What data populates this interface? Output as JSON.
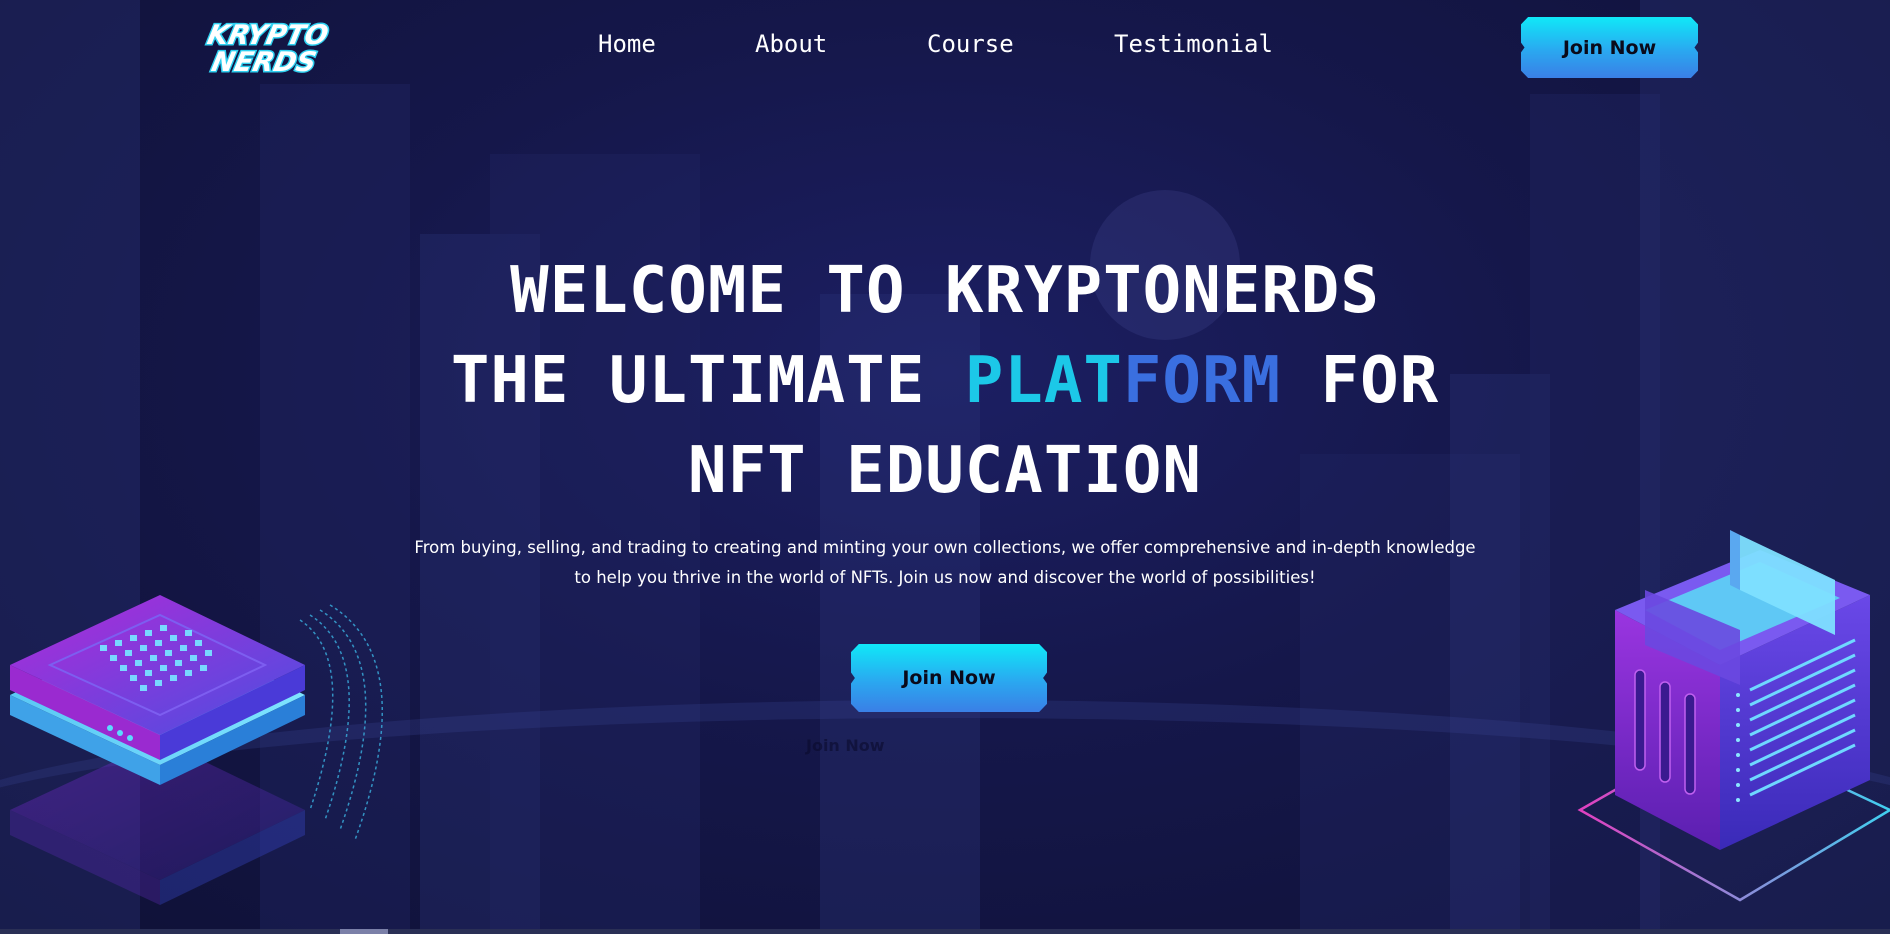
{
  "brand": {
    "logo_line1": "KRYPTO",
    "logo_line2": "NERDS"
  },
  "nav": {
    "items": [
      {
        "label": "Home"
      },
      {
        "label": "About"
      },
      {
        "label": "Course"
      },
      {
        "label": "Testimonial"
      }
    ],
    "cta_label": "Join Now"
  },
  "hero": {
    "title_line1": "WELCOME TO KRYPTONERDS",
    "title_line2_pre": "THE ULTIMATE ",
    "title_line2_accent_a": "PLAT",
    "title_line2_accent_b": "FORM",
    "title_line2_post": " FOR",
    "title_line3": "NFT EDUCATION",
    "subtitle": "From buying, selling, and trading to creating and minting your own collections, we offer comprehensive and in-depth knowledge to help you thrive in the world of NFTs. Join us now and discover the world of possibilities!",
    "cta_label": "Join Now",
    "ghost_label": "Join Now"
  },
  "colors": {
    "background": "#15174a",
    "accent_cyan": "#1cc8e8",
    "accent_blue": "#3a6fe0",
    "button_gradient_top": "#10e8f8",
    "button_gradient_bottom": "#3a7fe6",
    "illustration_purple": "#8a2be2"
  },
  "icons": {
    "left_illustration": "server-chip-stack-icon",
    "right_illustration": "isometric-data-tower-icon"
  }
}
